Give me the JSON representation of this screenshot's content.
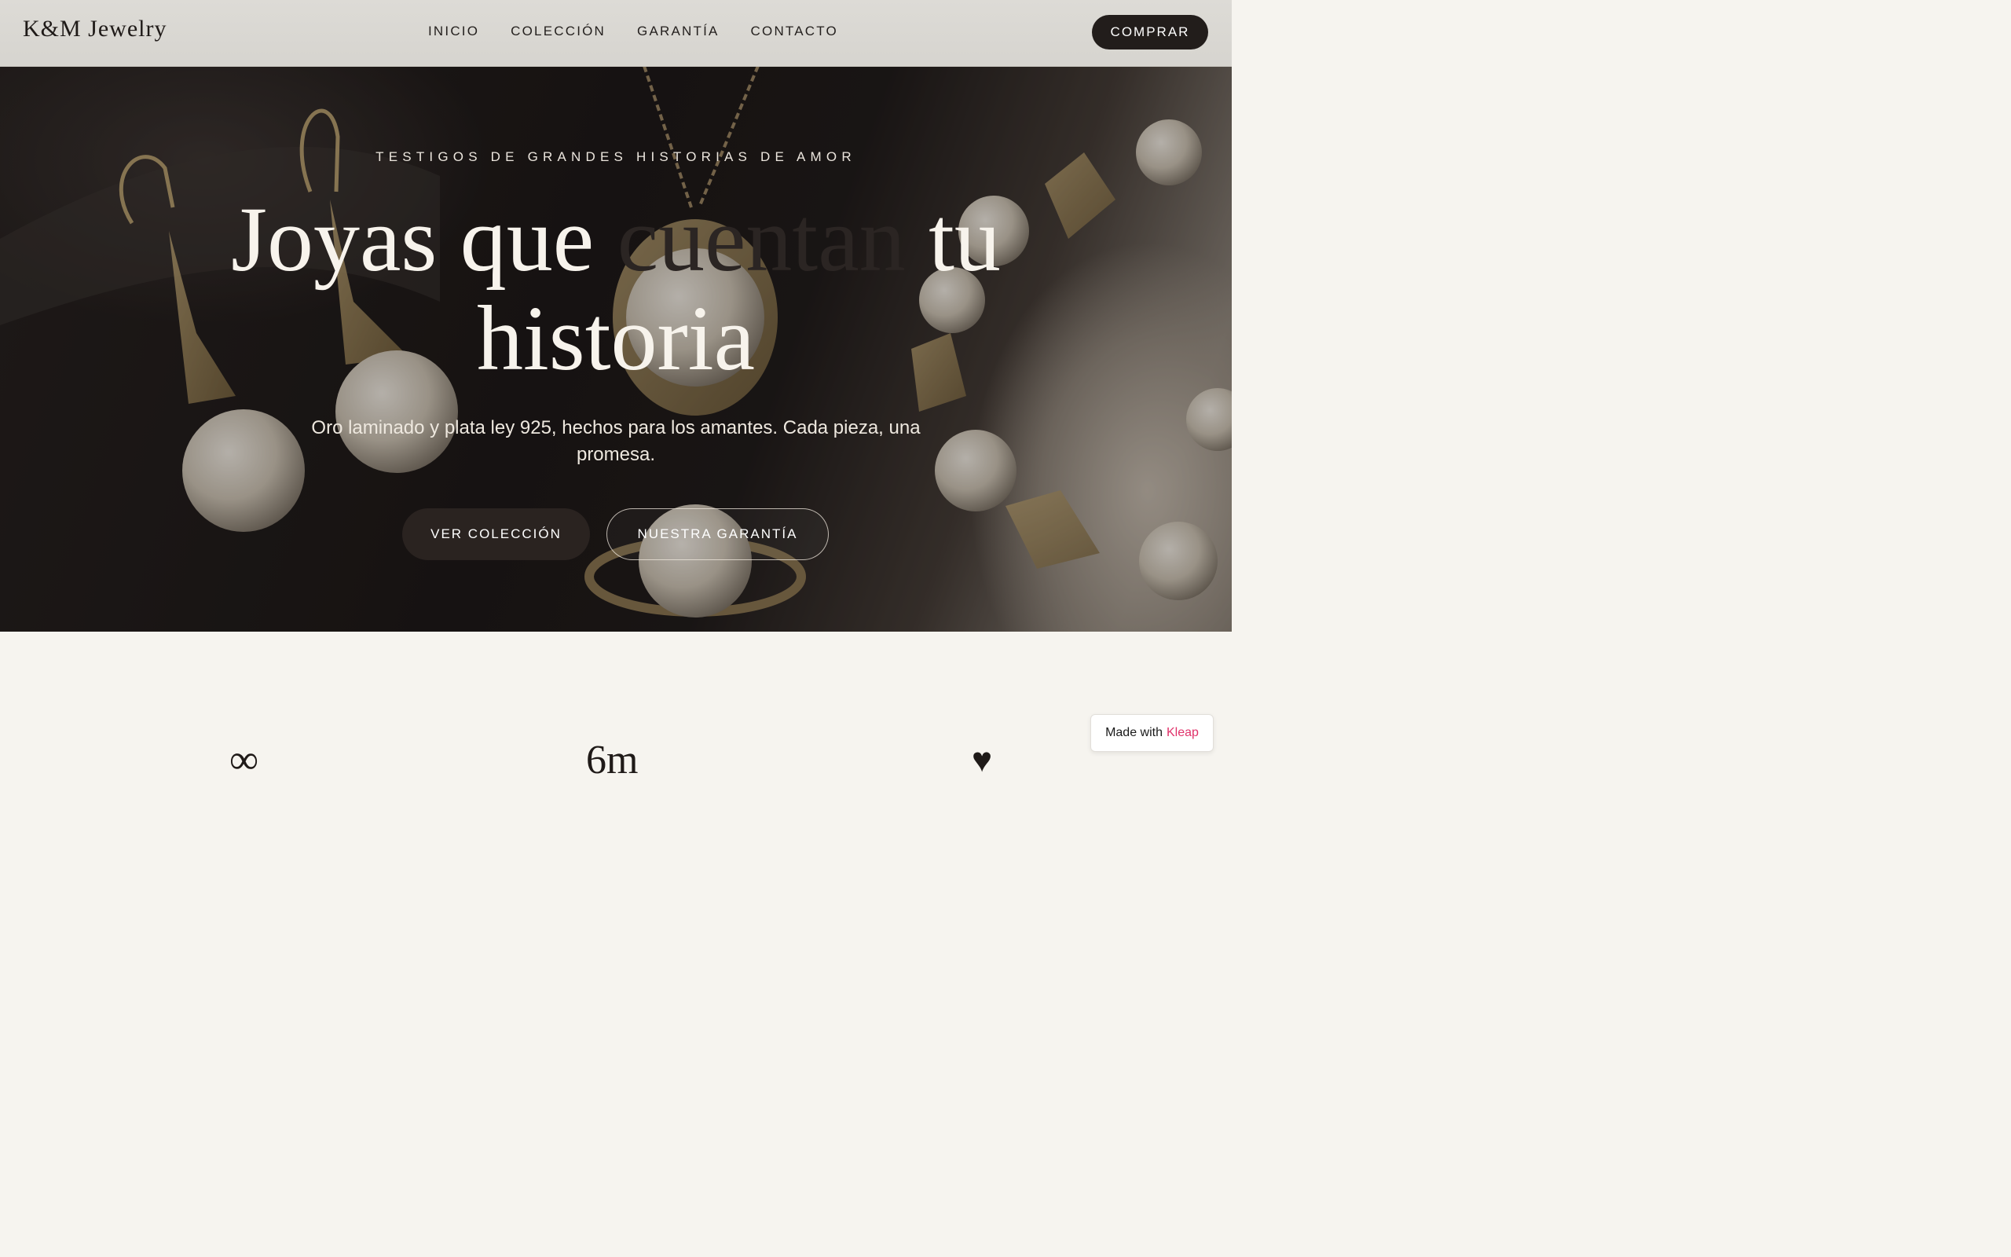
{
  "header": {
    "logo": "K&M Jewelry",
    "nav": [
      "INICIO",
      "COLECCIÓN",
      "GARANTÍA",
      "CONTACTO"
    ],
    "cta": "COMPRAR"
  },
  "hero": {
    "eyebrow": "TESTIGOS DE GRANDES HISTORIAS DE AMOR",
    "title_part1": "Joyas que ",
    "title_muted": "cuentan",
    "title_part2": " tu",
    "title_line2": "historia",
    "subtitle": "Oro laminado y plata ley 925, hechos para los amantes. Cada pieza, una promesa.",
    "primary_button": "VER COLECCIÓN",
    "secondary_button": "NUESTRA GARANTÍA"
  },
  "stats": {
    "infinity": "∞",
    "months": "6m",
    "heart": "♥"
  },
  "badge": {
    "prefix": "Made with",
    "brand": "Kleap"
  },
  "colors": {
    "dark": "#221d1b",
    "accent_brand": "#e0326a",
    "background": "#f6f4ef"
  }
}
